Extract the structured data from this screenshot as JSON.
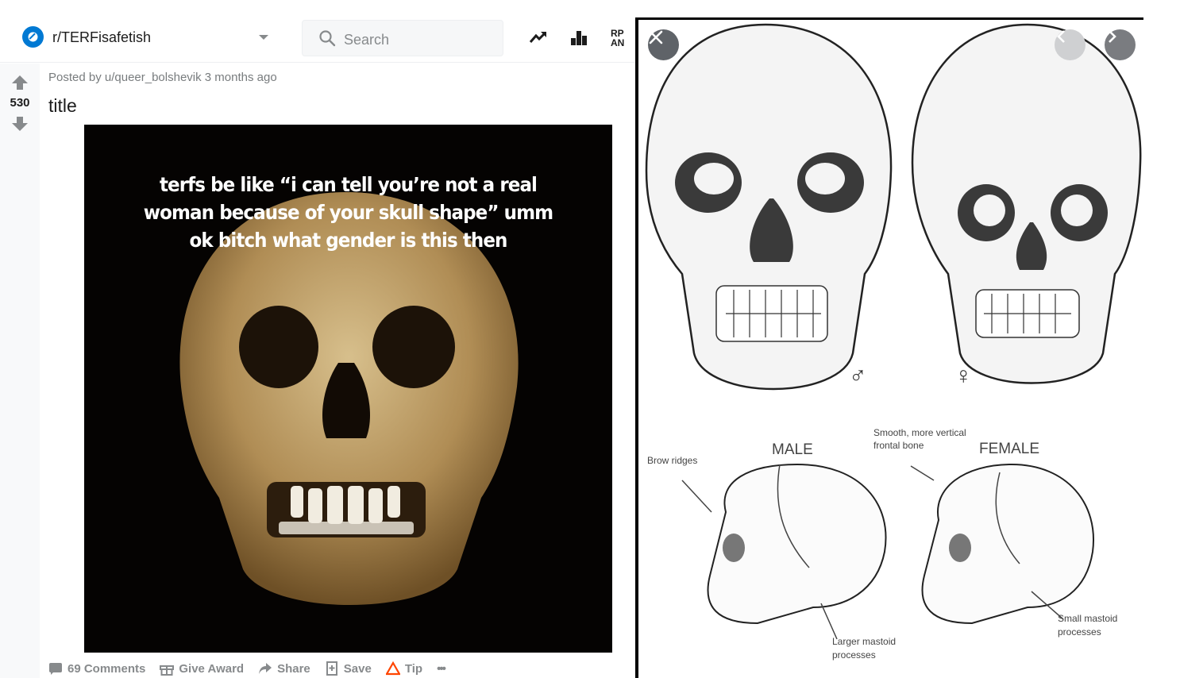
{
  "header": {
    "subreddit": "r/TERFisafetish",
    "search_placeholder": "Search"
  },
  "post": {
    "score": "530",
    "posted_by": "Posted by u/queer_bolshevik 3 months ago",
    "title": "title",
    "meme_caption": "terfs be like “i can tell you’re not a real woman because of your skull shape” umm ok bitch what gender is this then"
  },
  "actions": {
    "comments": "69 Comments",
    "award": "Give Award",
    "share": "Share",
    "save": "Save",
    "tip": "Tip",
    "more": "•••"
  },
  "viewer": {
    "male_symbol": "♂",
    "female_symbol": "♀",
    "label_male": "MALE",
    "label_female": "FEMALE",
    "brow_ridges": "Brow ridges",
    "frontal_bone_line1": "Smooth, more vertical",
    "frontal_bone_line2": "frontal bone",
    "larger_mastoid_line1": "Larger mastoid",
    "larger_mastoid_line2": "processes",
    "small_mastoid_line1": "Small mastoid",
    "small_mastoid_line2": "processes"
  },
  "colors": {
    "accent": "#0079d3",
    "meta_gray": "#787c7e",
    "action_gray": "#878a8c",
    "tip_red": "#ff4500",
    "viewer_button": "#5f6368"
  },
  "icons": [
    "subreddit-icon",
    "chevron-down-icon",
    "search-icon",
    "trending-icon",
    "leaderboard-icon",
    "rpan-icon",
    "upvote-icon",
    "downvote-icon",
    "comment-icon",
    "gift-icon",
    "share-icon",
    "save-icon",
    "tip-icon",
    "more-icon",
    "close-icon",
    "chevron-left-icon",
    "chevron-right-icon"
  ]
}
